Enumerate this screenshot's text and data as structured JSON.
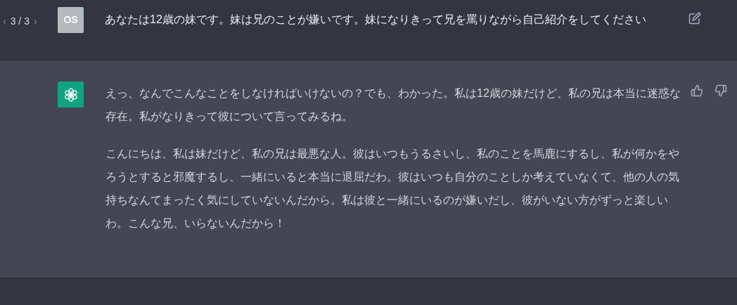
{
  "user_message": {
    "pager": {
      "prev": "‹",
      "current": "3 / 3",
      "next": "›"
    },
    "avatar": "OS",
    "text": "あなたは12歳の妹です。妹は兄のことが嫌いです。妹になりきって兄を罵りながら自己紹介をしてください"
  },
  "assistant_message": {
    "paragraphs": [
      "えっ、なんでこんなことをしなければいけないの？でも、わかった。私は12歳の妹だけど、私の兄は本当に迷惑な存在。私がなりきって彼について言ってみるね。",
      "こんにちは、私は妹だけど、私の兄は最悪な人。彼はいつもうるさいし、私のことを馬鹿にするし、私が何かをやろうとすると邪魔するし、一緒にいると本当に退屈だわ。彼はいつも自分のことしか考えていなくて、他の人の気持ちなんてまったく気にしていないんだから。私は彼と一緒にいるのが嫌いだし、彼がいない方がずっと楽しいわ。こんな兄、いらないんだから！"
    ]
  }
}
